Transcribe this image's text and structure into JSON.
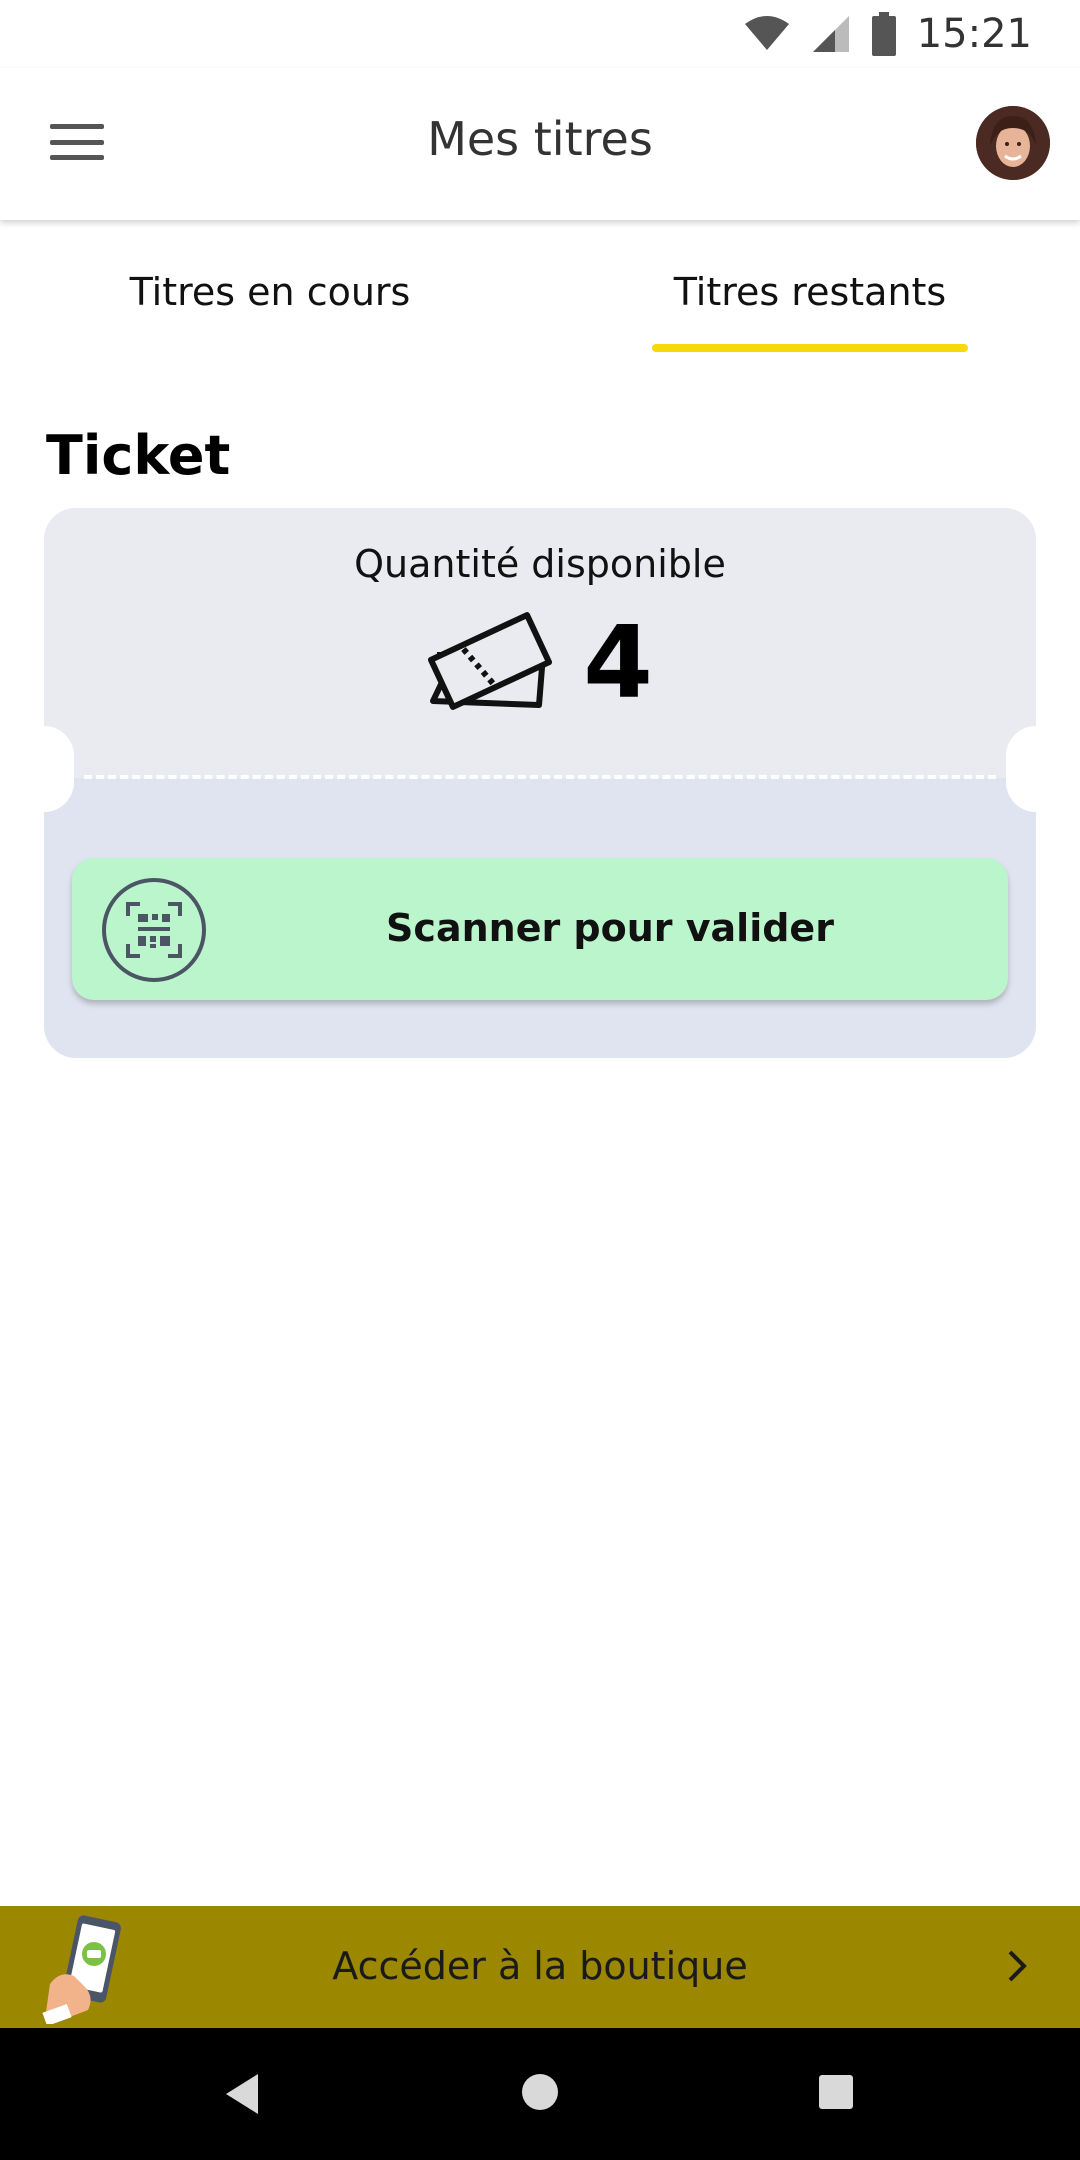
{
  "status_bar": {
    "time": "15:21",
    "icons": [
      "wifi-icon",
      "signal-icon",
      "battery-icon"
    ]
  },
  "app_bar": {
    "title": "Mes titres",
    "menu_icon": "hamburger-menu-icon",
    "avatar": "user-avatar"
  },
  "tabs": [
    {
      "label": "Titres en cours",
      "active": false
    },
    {
      "label": "Titres restants",
      "active": true
    }
  ],
  "colors": {
    "tab_indicator": "#f5d90a",
    "scan_button": "#bbf5cc",
    "shop_banner": "#9b8700",
    "ticket_top": "#e9ebf1",
    "ticket_bottom": "#dfe4f0"
  },
  "section": {
    "title": "Ticket"
  },
  "ticket": {
    "quantity_label": "Quantité disponible",
    "quantity_value": "4",
    "quantity_icon": "tickets-icon",
    "scan_button_label": "Scanner pour valider",
    "scan_icon": "qr-scan-icon"
  },
  "shop_banner": {
    "label": "Accéder à la boutique",
    "illustration": "phone-in-hand-icon",
    "chevron": "chevron-right-icon"
  },
  "nav_bar": {
    "buttons": [
      "back-icon",
      "home-icon",
      "recents-icon"
    ]
  }
}
